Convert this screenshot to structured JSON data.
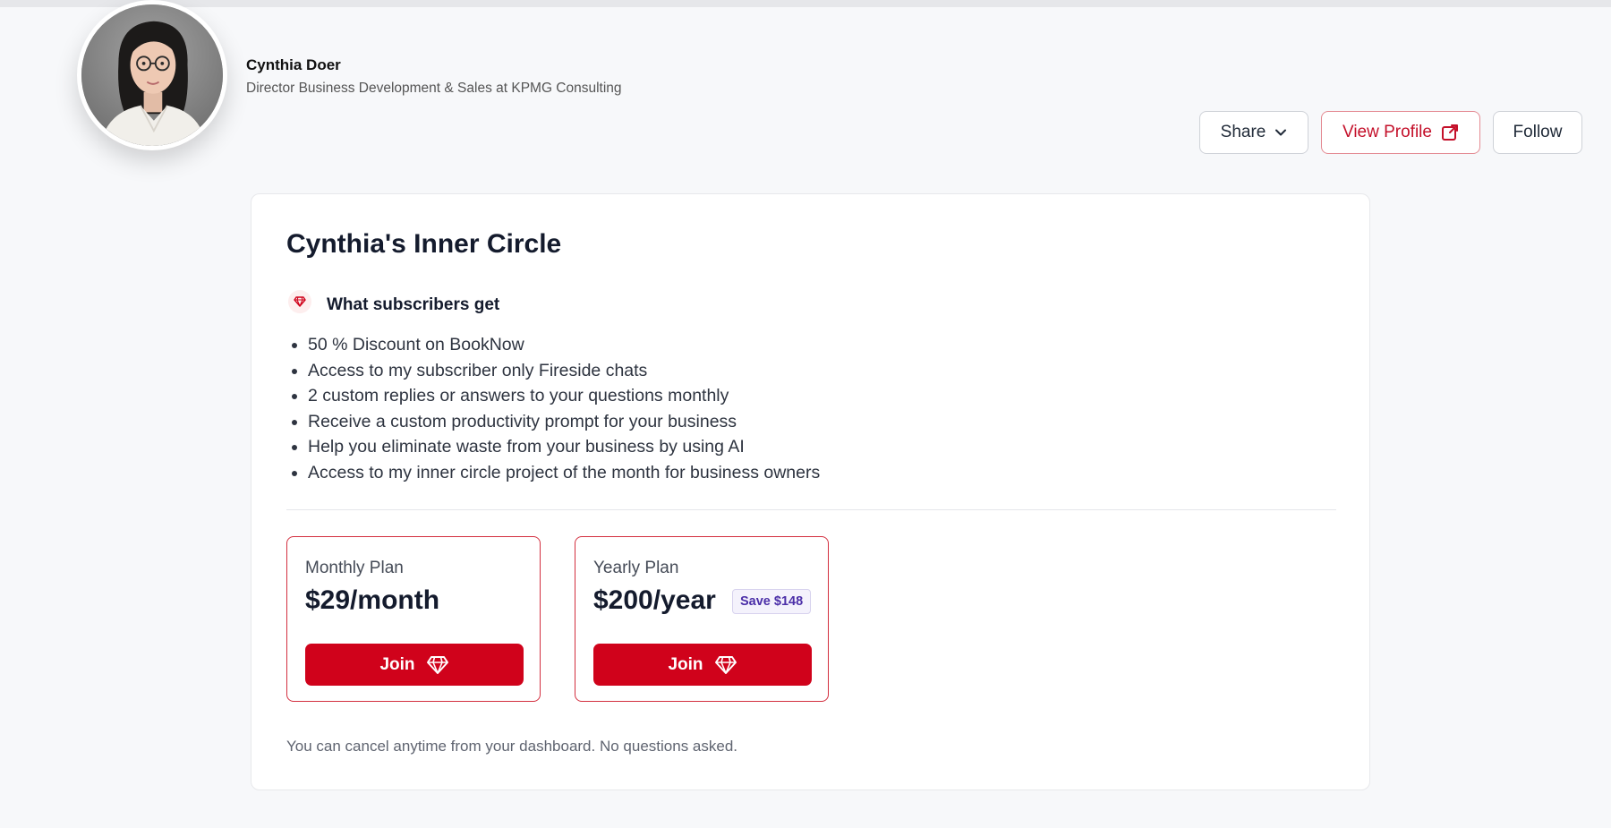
{
  "profile": {
    "name": "Cynthia Doer",
    "title": "Director Business Development & Sales at KPMG Consulting"
  },
  "actions": {
    "share_label": "Share",
    "view_profile_label": "View Profile",
    "follow_label": "Follow"
  },
  "subscription": {
    "title": "Cynthia's Inner Circle",
    "benefits_heading": "What subscribers get",
    "benefits": [
      "50 % Discount on BookNow",
      "Access to my subscriber only Fireside chats",
      "2 custom replies or answers to your questions monthly",
      "Receive a custom productivity prompt for your business",
      "Help you eliminate waste from your business by using AI",
      "Access to my inner circle project of the month for business owners"
    ],
    "plans": [
      {
        "label": "Monthly Plan",
        "price": "$29/month",
        "join_label": "Join"
      },
      {
        "label": "Yearly Plan",
        "price": "$200/year",
        "badge": "Save $148",
        "join_label": "Join"
      }
    ],
    "cancel_note": "You can cancel anytime from your dashboard. No questions asked."
  },
  "icons": {
    "share_dropdown": "chevron-down-icon",
    "view_profile": "external-link-icon",
    "benefits": "diamond-icon",
    "join": "diamond-icon"
  },
  "colors": {
    "brand_red": "#d0021b",
    "accent_red_text": "#c4102a",
    "badge_purple": "#4b2fa8",
    "page_background": "#f7f8fa"
  }
}
